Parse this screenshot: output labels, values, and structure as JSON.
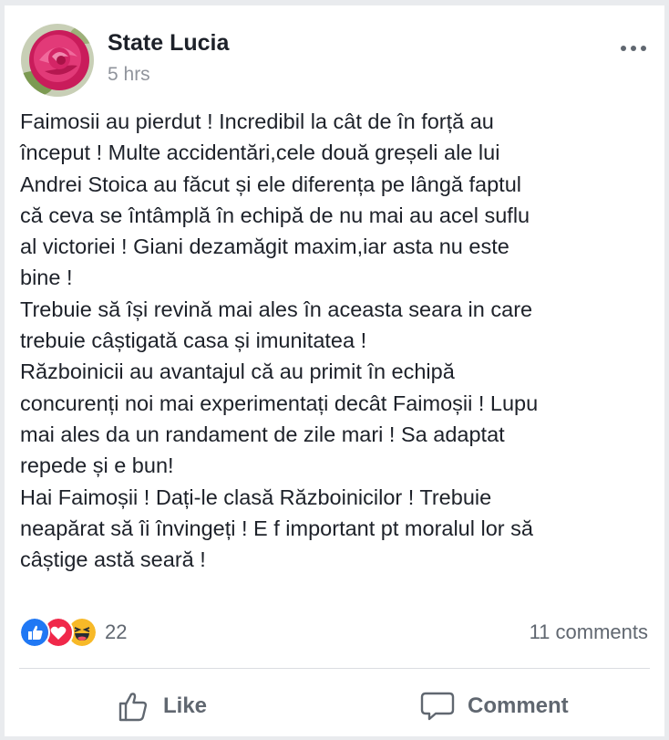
{
  "post": {
    "author": "State Lucia",
    "timestamp": "5 hrs",
    "text_lines": [
      "Faimosii au pierdut ! Incredibil la cât de în forță au",
      "început ! Multe accidentări,cele două greșeli ale lui",
      "Andrei Stoica au făcut și ele diferența pe lângă faptul",
      "că ceva se întâmplă în echipă de nu mai au acel suflu",
      "al victoriei ! Giani dezamăgit maxim,iar asta nu este",
      "bine !",
      "Trebuie să își revină mai ales în aceasta seara in care",
      "trebuie câștigată casa și imunitatea !",
      "Războinicii au avantajul că au primit în echipă",
      "concurenți noi mai experimentați decât Faimoșii ! Lupu",
      "mai ales da un randament de zile mari ! Sa adaptat",
      "repede și e bun!",
      "Hai Faimoșii ! Dați-le clasă Războinicilor ! Trebuie",
      "neapărat să îi învingeți ! E f important pt moralul lor să",
      "câștige astă seară !"
    ]
  },
  "reactions": {
    "count": "22",
    "types": [
      "like-icon",
      "love-icon",
      "haha-icon"
    ],
    "colors": {
      "like": "#2078f4",
      "love": "#f0284a",
      "haha": "#f7b928"
    }
  },
  "comments": {
    "count_label": "11 comments"
  },
  "actions": {
    "like_label": "Like",
    "comment_label": "Comment"
  }
}
